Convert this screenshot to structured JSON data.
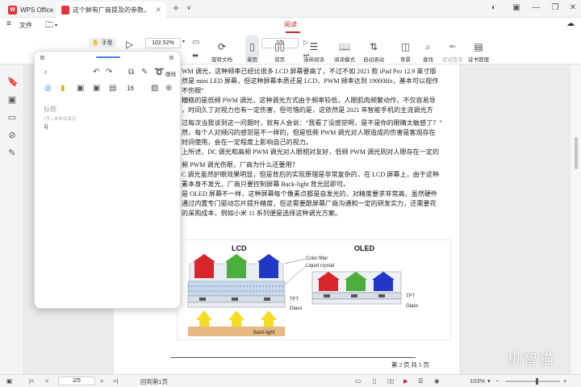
{
  "titlebar": {
    "app_tab": "WPS Office",
    "doc_tab": "这个鲜有厂商提及的参数，影响…",
    "new_tab_symbol": "+",
    "dropdown_symbol": "∨"
  },
  "menu": {
    "file": "文件",
    "read": "阅读"
  },
  "ribbon": {
    "hand_tool": "手型",
    "zoom_value": "102.52%",
    "page_input": "2/5",
    "rotate": "旋转文档",
    "single_page": "单页",
    "double_page": "双页",
    "continuous": "连续阅读",
    "reading_mode": "阅读模式",
    "auto_scroll": "自动滚动",
    "background": "背景",
    "search": "查找",
    "verify_sign": "验证签名",
    "cert_manage": "证书管理"
  },
  "note_window": {
    "toolbar_label": "画线",
    "font_size": "16",
    "title_placeholder": "标题",
    "meta": "1字 | 未命名笔记",
    "body_text": "1|"
  },
  "document": {
    "lines": [
      "WM 调光，这种频率已经比很多 LCD 屏幕要高了，不过不如 2021 款 iPad Pro 12.9 英寸版",
      "然是 mini LED 屏幕，但这种屏幕本质还是 LCD，PWM 频率达到 19000Hz，基本可以视作",
      "不伤眼”",
      "糟糕的是低频 PWM 调光，这种调光方式由于频率较低，人眼肌肉频繁动作，不仅容易导",
      "，时间久了对视力也有一定伤害，但可惜的是，这依然是 2021 年智能手机的主流调光方",
      "",
      "过每次当我谈到这一问题时，就有人会说：“我看了没感觉啊，是不是你的眼睛太敏感了？”",
      "然，每个人对频闪的感觉是不一样的，但是低频 PWM 调光对人眼造成的伤害是客观存在",
      "时间使用，会在一定程度上影响自己的视力。",
      "上所述，DC 调光和高频 PWM 调光对人眼相对友好，低频 PWM 调光则对人眼存在一定的",
      "",
      "频 PWM 调光伤眼，厂商为什么还要用？",
      "C 调光虽然护眼效果明显，但是背后的实现原理是非常复杂的，在 LCD 屏幕上，由于这种",
      "素本身不发光，厂商只要控制屏幕 Back-light 背光层即可。",
      "是 OLED 屏幕不一样，这种屏幕每个像素点都是自发光的，对精度要求非常高，虽然硬件",
      "通过内置专门驱动芯片提升精度，但这需要跟屏幕厂商沟通和一定的研发实力，还需要花",
      "的采购成本，例如小米 11 系列便是选择这种调光方案。"
    ],
    "footer": "第 2 页  共 5 页"
  },
  "figure": {
    "lcd_label": "LCD",
    "oled_label": "OLED",
    "color_filter": "Color filter",
    "liquid_crystal": "Liquid crystal",
    "tft_left": "TFT",
    "glass_left": "Glass",
    "tft_right": "TFT",
    "glass_right": "Glass",
    "backlight": "Back-light"
  },
  "statusbar": {
    "page_input": "2/5",
    "back_to_first": "回到第1页",
    "zoom": "103%"
  },
  "watermark": "机智猫",
  "colors": {
    "accent": "#c8262c",
    "red_px": "#d9262b",
    "green_px": "#4cae3c",
    "blue_px": "#2137c5",
    "yellow_backlight": "#f5dd27",
    "lcd_stack": "#c7d6ea"
  }
}
